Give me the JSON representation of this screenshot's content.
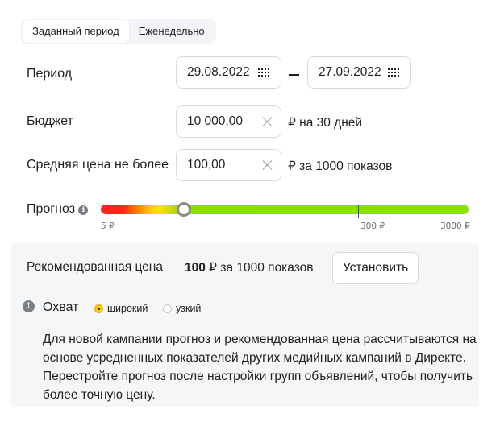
{
  "tabs": [
    {
      "label": "Заданный период",
      "active": true
    },
    {
      "label": "Еженедельно",
      "active": false
    }
  ],
  "period": {
    "label": "Период",
    "start_date": "29.08.2022",
    "end_date": "27.09.2022",
    "icon": "calendar-icon"
  },
  "budget": {
    "label": "Бюджет",
    "value": "10 000,00",
    "suffix": "₽ на 30 дней",
    "icon": "clear-icon"
  },
  "avg_price": {
    "label": "Средняя цена не более",
    "value": "100,00",
    "suffix": "₽ за 1000 показов",
    "icon": "clear-icon"
  },
  "forecast": {
    "label": "Прогноз",
    "info_icon": "i",
    "scale_min": "5 ₽",
    "scale_mid": "300 ₽",
    "scale_max": "3000 ₽",
    "slider_value": 100,
    "colors": {
      "low": "#ff1f1f",
      "mid": "#ffd400",
      "high": "#8ce10a"
    }
  },
  "recommendation": {
    "label": "Рекомендованная цена",
    "price": "100",
    "price_suffix": " ₽ за 1000 показов",
    "button_label": "Установить"
  },
  "reach": {
    "label": "Охват",
    "info_icon": "!",
    "options": [
      {
        "label": "широкий",
        "checked": true
      },
      {
        "label": "узкий",
        "checked": false
      }
    ],
    "accent": "#ffcc00"
  },
  "note": "Для новой кампании прогноз и рекомендованная цена рассчитываются на основе усредненных показателей других медийных кампаний в Директе. Перестройте прогноз после настройки групп объявлений, чтобы получить более точную цену."
}
